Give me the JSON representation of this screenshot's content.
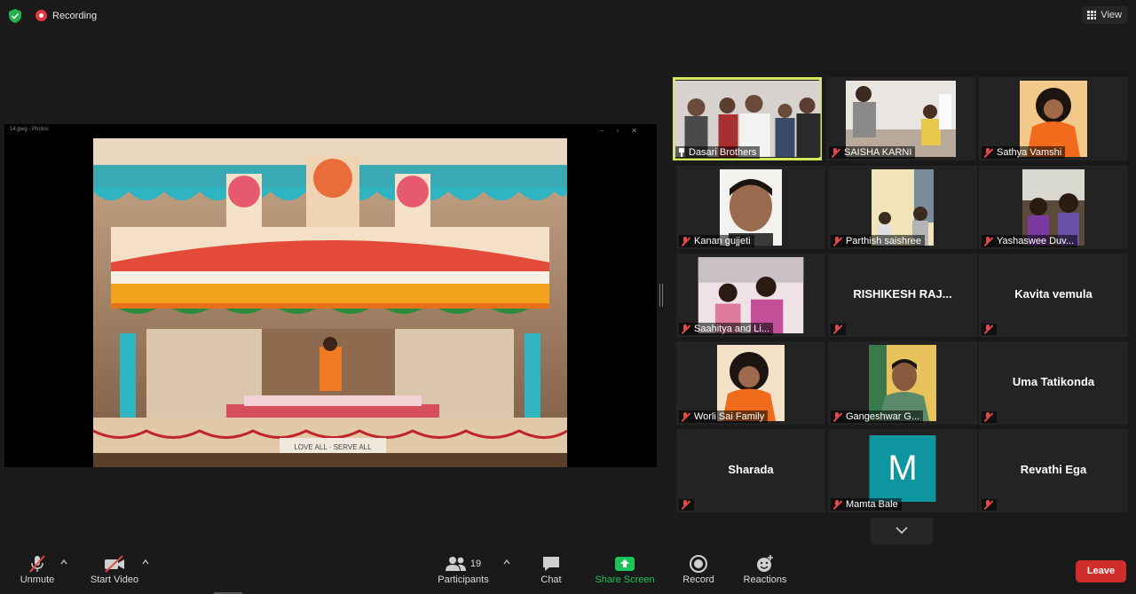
{
  "top": {
    "recording_label": "Recording",
    "view_label": "View"
  },
  "share": {
    "window_title": "14.jpeg - Photos",
    "photo_banner_text": "LOVE ALL · SERVE ALL"
  },
  "participants_tiles": [
    {
      "name": "Dasari Brothers",
      "video": true,
      "pinned": true,
      "active": true
    },
    {
      "name": "SAISHA KARNI",
      "video": true,
      "muted": true
    },
    {
      "name": "Sathya Vamshi",
      "video": true,
      "muted": true
    },
    {
      "name": "Kanan gujjeti",
      "video": true,
      "muted": true
    },
    {
      "name": "Parthish saishree",
      "video": true,
      "muted": true
    },
    {
      "name": "Yashaswee Duv...",
      "video": true,
      "muted": true
    },
    {
      "name": "Saahitya and Li...",
      "video": true,
      "muted": true
    },
    {
      "name": "RISHIKESH  RAJ...",
      "video": false,
      "muted": true
    },
    {
      "name": "Kavita vemula",
      "video": false,
      "muted": true
    },
    {
      "name": "Worli Sai Family",
      "video": true,
      "muted": true
    },
    {
      "name": "Gangeshwar G...",
      "video": true,
      "muted": true
    },
    {
      "name": "Uma Tatikonda",
      "video": false,
      "muted": true
    },
    {
      "name": "Sharada",
      "video": false,
      "muted": true
    },
    {
      "name": "Mamta Bale",
      "video": false,
      "avatar_letter": "M",
      "muted": true
    },
    {
      "name": "Revathi Ega",
      "video": false,
      "muted": true
    }
  ],
  "toolbar": {
    "unmute": "Unmute",
    "start_video": "Start Video",
    "participants_count": "19",
    "participants": "Participants",
    "chat": "Chat",
    "share_screen": "Share Screen",
    "record": "Record",
    "reactions": "Reactions",
    "leave": "Leave"
  },
  "colors": {
    "active_speaker_border": "#d6e95c",
    "share_green": "#1cc35a",
    "leave_red": "#d22d2d",
    "avatar_teal": "#0e96a0"
  }
}
